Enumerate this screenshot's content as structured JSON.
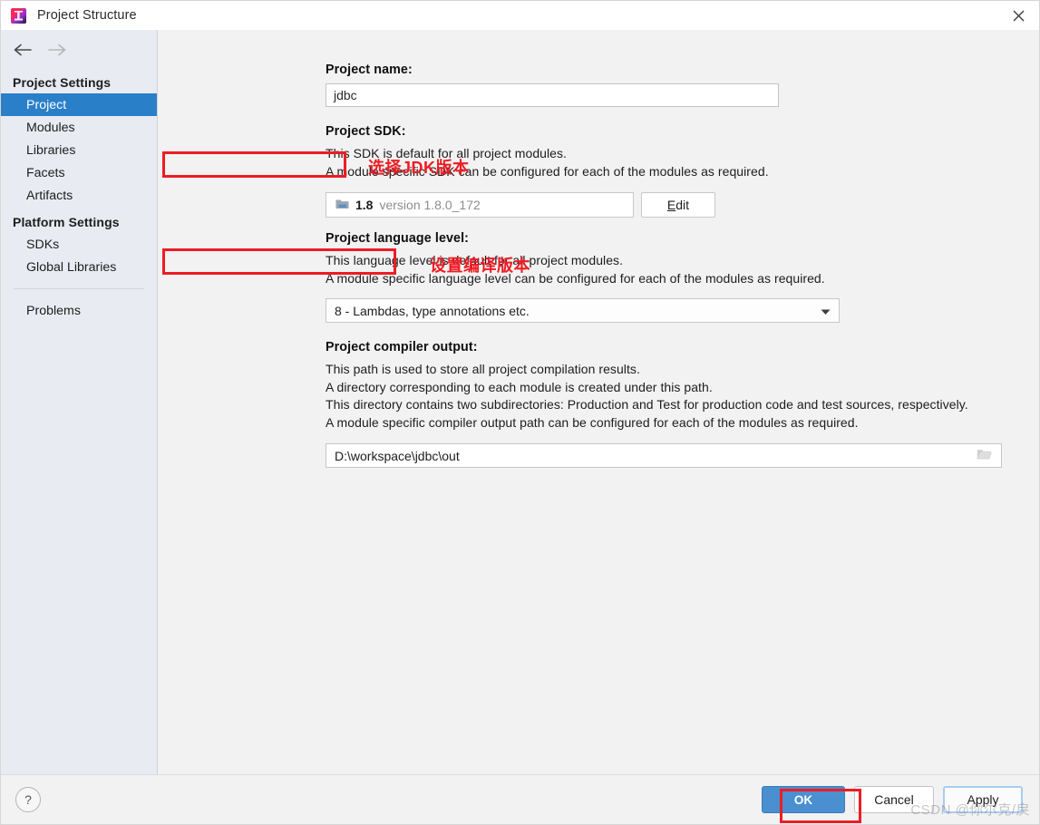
{
  "window": {
    "title": "Project Structure",
    "app_icon": "intellij-idea-icon",
    "close_icon": "close-icon"
  },
  "sidebar": {
    "back_icon": "arrow-left-icon",
    "forward_icon": "arrow-right-icon",
    "groups": [
      {
        "title": "Project Settings",
        "items": [
          {
            "label": "Project",
            "selected": true
          },
          {
            "label": "Modules",
            "selected": false
          },
          {
            "label": "Libraries",
            "selected": false
          },
          {
            "label": "Facets",
            "selected": false
          },
          {
            "label": "Artifacts",
            "selected": false
          }
        ]
      },
      {
        "title": "Platform Settings",
        "items": [
          {
            "label": "SDKs",
            "selected": false
          },
          {
            "label": "Global Libraries",
            "selected": false
          }
        ]
      }
    ],
    "extra_items": [
      {
        "label": "Problems",
        "selected": false
      }
    ]
  },
  "main": {
    "project_name": {
      "label": "Project name:",
      "value": "jdbc"
    },
    "project_sdk": {
      "label": "Project SDK:",
      "desc_line_1": "This SDK is default for all project modules.",
      "desc_line_2": "A module specific SDK can be configured for each of the modules as required.",
      "sdk_icon": "folder-sdk-icon",
      "sdk_name": "1.8",
      "sdk_version": "version 1.8.0_172",
      "edit_label": "Edit",
      "edit_mnemonic": "E",
      "edit_rest": "dit"
    },
    "language_level": {
      "label": "Project language level:",
      "desc_line_1": "This language level is default for all project modules.",
      "desc_line_2": "A module specific language level can be configured for each of the modules as required.",
      "value": "8 - Lambdas, type annotations etc.",
      "dropdown_icon": "chevron-down-icon"
    },
    "compiler_output": {
      "label": "Project compiler output:",
      "desc_line_1": "This path is used to store all project compilation results.",
      "desc_line_2": "A directory corresponding to each module is created under this path.",
      "desc_line_3": "This directory contains two subdirectories: Production and Test for production code and test sources, respectively.",
      "desc_line_4": "A module specific compiler output path can be configured for each of the modules as required.",
      "value": "D:\\workspace\\jdbc\\out",
      "browse_icon": "folder-browse-icon"
    }
  },
  "annotations": {
    "accent_color": "#ee1c24",
    "sdk_note": "选择JDK版本",
    "language_note": "设置编译版本"
  },
  "footer": {
    "help_label": "?",
    "ok_label": "OK",
    "cancel_label": "Cancel",
    "apply_label": "Apply"
  },
  "watermark": {
    "text": "CSDN @你尔克/戾"
  }
}
